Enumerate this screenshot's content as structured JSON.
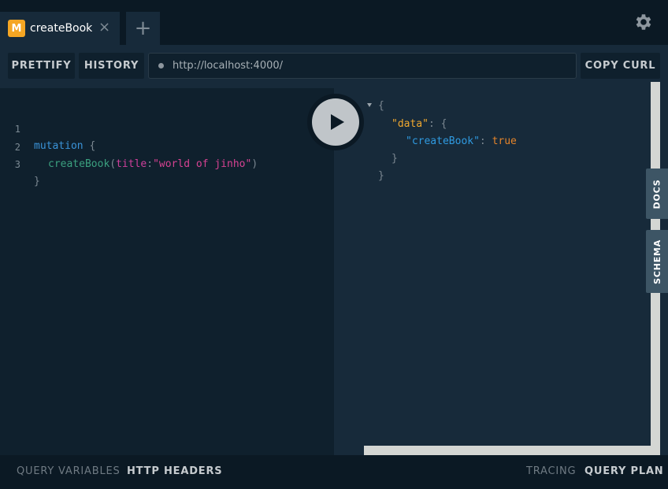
{
  "tabs": [
    {
      "badge": "M",
      "title": "createBook",
      "close": "×"
    }
  ],
  "tab_add": "+",
  "toolbar": {
    "prettify": "PRETTIFY",
    "history": "HISTORY",
    "url": "http://localhost:4000/",
    "copy_curl": "COPY CURL"
  },
  "editor": {
    "line_numbers": [
      "1",
      "2",
      "3"
    ],
    "line1": {
      "keyword": "mutation",
      "brace": " {"
    },
    "line2": {
      "fn": "createBook",
      "open": "(",
      "arg": "title",
      "colon": ":",
      "value": "\"world of jinho\"",
      "close": ")"
    },
    "line3": {
      "brace": "}"
    }
  },
  "result": {
    "open": "{",
    "data_key": "\"data\"",
    "data_colon": ": {",
    "field_key": "\"createBook\"",
    "field_colon": ": ",
    "field_value": "true",
    "inner_close": "}",
    "outer_close": "}"
  },
  "side_tabs": {
    "docs": "DOCS",
    "schema": "SCHEMA"
  },
  "bottom": {
    "query_variables": "QUERY VARIABLES",
    "http_headers": "HTTP HEADERS",
    "tracing": "TRACING",
    "query_plan": "QUERY PLAN"
  },
  "colors": {
    "badge": "#f5a623",
    "keyword": "#3a93d8",
    "function": "#3ba07f",
    "string": "#d64292",
    "json_data_key": "#f0a82f",
    "json_key": "#2f9ae0",
    "json_bool": "#e5842a"
  },
  "icons": [
    "settings-gear-icon",
    "play-icon",
    "close-icon",
    "plus-icon",
    "fold-triangle-icon"
  ]
}
